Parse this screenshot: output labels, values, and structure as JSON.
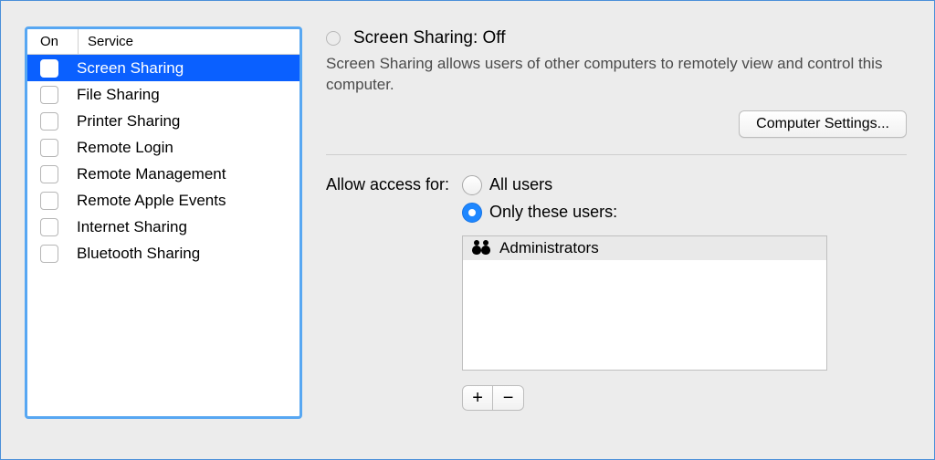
{
  "services": {
    "header": {
      "on": "On",
      "service": "Service"
    },
    "items": [
      {
        "label": "Screen Sharing",
        "checked": false,
        "selected": true
      },
      {
        "label": "File Sharing",
        "checked": false,
        "selected": false
      },
      {
        "label": "Printer Sharing",
        "checked": false,
        "selected": false
      },
      {
        "label": "Remote Login",
        "checked": false,
        "selected": false
      },
      {
        "label": "Remote Management",
        "checked": false,
        "selected": false
      },
      {
        "label": "Remote Apple Events",
        "checked": false,
        "selected": false
      },
      {
        "label": "Internet Sharing",
        "checked": false,
        "selected": false
      },
      {
        "label": "Bluetooth Sharing",
        "checked": false,
        "selected": false
      }
    ]
  },
  "detail": {
    "status_title": "Screen Sharing: Off",
    "description": "Screen Sharing allows users of other computers to remotely view and control this computer.",
    "settings_button": "Computer Settings..."
  },
  "access": {
    "label": "Allow access for:",
    "options": {
      "all_users": {
        "label": "All users",
        "checked": false
      },
      "only_these": {
        "label": "Only these users:",
        "checked": true
      }
    },
    "users": [
      {
        "label": "Administrators"
      }
    ],
    "add_label": "+",
    "remove_label": "−"
  }
}
